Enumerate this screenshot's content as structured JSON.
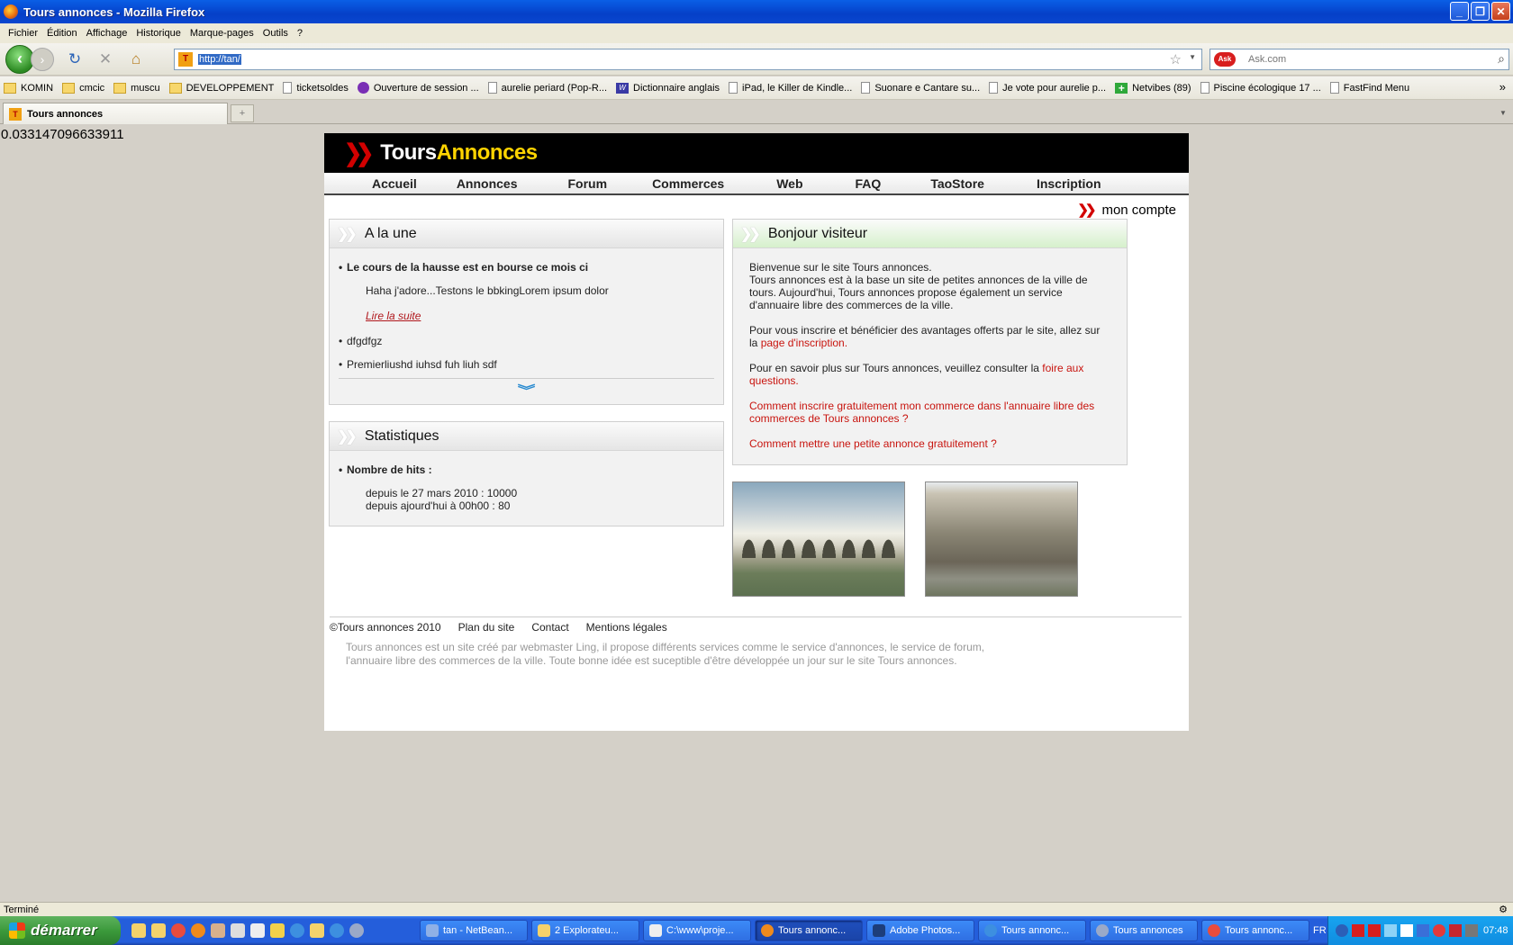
{
  "window": {
    "title": "Tours annonces - Mozilla Firefox",
    "controls": [
      "_",
      "❐",
      "✕"
    ]
  },
  "menu": [
    "Fichier",
    "Édition",
    "Affichage",
    "Historique",
    "Marque-pages",
    "Outils",
    "?"
  ],
  "nav": {
    "url": "http://tan/",
    "search_placeholder": "Ask.com"
  },
  "bookmarks": [
    {
      "label": "KOMIN",
      "icon": "folder-icon"
    },
    {
      "label": "cmcic",
      "icon": "folder-icon"
    },
    {
      "label": "muscu",
      "icon": "folder-icon"
    },
    {
      "label": "DEVELOPPEMENT",
      "icon": "folder-icon"
    },
    {
      "label": "ticketsoldes",
      "icon": "page-icon"
    },
    {
      "label": "Ouverture de session ...",
      "icon": "yahoo-icon"
    },
    {
      "label": "aurelie periard (Pop-R...",
      "icon": "page-icon"
    },
    {
      "label": "Dictionnaire anglais",
      "icon": "wordreference-icon"
    },
    {
      "label": "iPad, le Killer de Kindle...",
      "icon": "page-icon"
    },
    {
      "label": "Suonare e Cantare su...",
      "icon": "page-icon"
    },
    {
      "label": "Je vote pour aurelie p...",
      "icon": "page-icon"
    },
    {
      "label": "Netvibes (89)",
      "icon": "netvibes-icon"
    },
    {
      "label": "Piscine écologique 17 ...",
      "icon": "page-icon"
    },
    {
      "label": "FastFind Menu",
      "icon": "page-icon"
    }
  ],
  "tab": {
    "label": "Tours annonces",
    "newtab": "+"
  },
  "page": {
    "debug_number": "0.033147096633911",
    "logo_part1": "Tours",
    "logo_part2": "Annonces",
    "mainnav": [
      "Accueil",
      "Annonces",
      "Forum",
      "Commerces",
      "Web",
      "FAQ",
      "TaoStore",
      "Inscription"
    ],
    "account_label": "mon compte",
    "une": {
      "title": "A la une",
      "item1_title": "Le cours de la hausse est en bourse ce mois ci",
      "item1_text": "Haha j'adore...Testons le bbkingLorem ipsum dolor",
      "read_more": "Lire la suite",
      "item2": "dfgdfgz",
      "item3": "Premierliushd iuhsd fuh liuh sdf"
    },
    "stats": {
      "title": "Statistiques",
      "hits_label": "Nombre de hits :",
      "line1": "depuis le 27 mars 2010 : 10000",
      "line2": "depuis ajourd'hui à 00h00 : 80"
    },
    "welcome": {
      "title": "Bonjour visiteur",
      "p1": "Bienvenue sur le site Tours annonces.",
      "p2": "Tours annonces est à la base un site de petites annonces de la ville de tours. Aujourd'hui, Tours annonces propose également un service d'annuaire libre des commerces de la ville.",
      "p3_text": "Pour vous inscrire et bénéficier des avantages offerts par le site, allez sur la ",
      "p3_link": "page d'inscription.",
      "p4_text": "Pour en savoir plus sur Tours annonces, veuillez consulter la ",
      "p4_link": "foire aux questions.",
      "link1": "Comment inscrire gratuitement mon commerce dans l'annuaire libre des commerces de Tours annonces ?",
      "link2": "Comment mettre une petite annonce gratuitement ?"
    },
    "footer": {
      "copyright": "©Tours annonces 2010",
      "links": [
        "Plan du site",
        "Contact",
        "Mentions légales"
      ],
      "about": "Tours annonces est un site créé par webmaster Ling, il propose différents services comme le service d'annonces, le service de forum, l'annuaire libre des commerces de la ville. Toute bonne idée est suceptible d'être développée un jour sur le site Tours annonces."
    },
    "colors": {
      "brand_red": "#d20000",
      "brand_yellow": "#ffd400",
      "link_red": "#c8140e"
    }
  },
  "statusbar": {
    "text": "Terminé"
  },
  "taskbar": {
    "start": "démarrer",
    "buttons": [
      "tan - NetBean...",
      "2 Explorateu...",
      "C:\\www\\proje...",
      "Tours annonc...",
      "Adobe Photos...",
      "Tours annonc...",
      "Tours annonces",
      "Tours annonc..."
    ],
    "lang": "FR",
    "clock": "07:48"
  }
}
